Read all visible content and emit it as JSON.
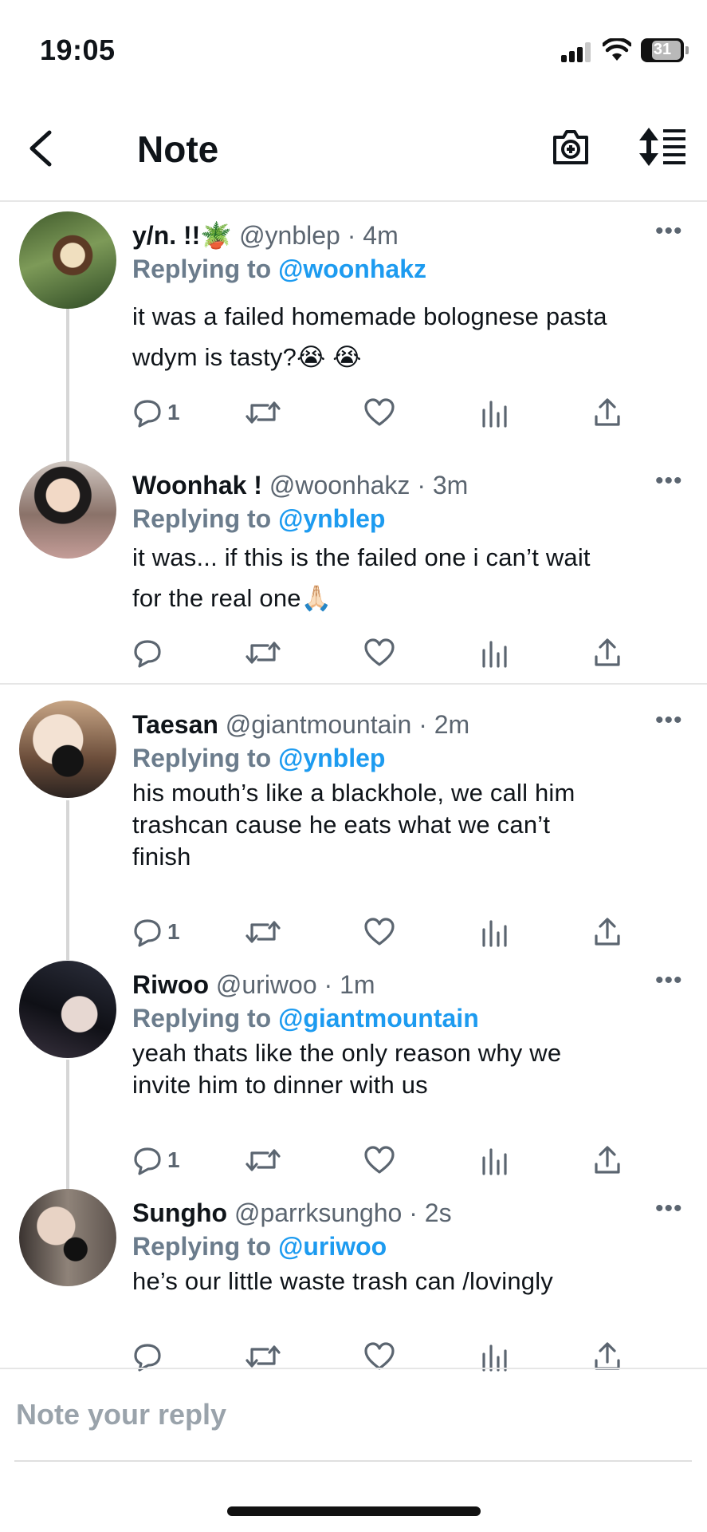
{
  "status_bar": {
    "time": "19:05",
    "battery": "31"
  },
  "header": {
    "title": "Note",
    "back_icon": "chevron-left-icon",
    "camera_icon": "camera-plus-icon",
    "sort_icon": "sort-lines-icon"
  },
  "tweets": [
    {
      "name": "y/n. !!🪴",
      "handle": "@ynblep · 4m",
      "reply_prefix": "Replying to",
      "reply_to": "@woonhakz",
      "lines": [
        "it was a failed homemade bolognese pasta",
        "wdym is tasty?😭 😭"
      ],
      "reply_count": "1"
    },
    {
      "name": "Woonhak !",
      "handle": "@woonhakz · 3m",
      "reply_prefix": "Replying to",
      "reply_to": "@ynblep",
      "lines": [
        "it was... if this is the failed one i can’t wait",
        "for the real one🙏🏻"
      ],
      "reply_count": ""
    },
    {
      "name": "Taesan",
      "handle": "@giantmountain · 2m",
      "reply_prefix": "Replying to",
      "reply_to": "@ynblep",
      "lines": [
        "his mouth’s like a blackhole, we call him",
        "trashcan cause he eats what we can’t",
        "finish"
      ],
      "reply_count": "1"
    },
    {
      "name": "Riwoo",
      "handle": "@uriwoo · 1m",
      "reply_prefix": "Replying to",
      "reply_to": "@giantmountain",
      "lines": [
        "yeah thats like the only reason why we",
        "invite him to dinner with us"
      ],
      "reply_count": "1"
    },
    {
      "name": "Sungho",
      "handle": "@parrksungho · 2s",
      "reply_prefix": "Replying to",
      "reply_to": "@uriwoo",
      "lines": [
        "he’s our little waste trash can /lovingly"
      ],
      "reply_count": ""
    }
  ],
  "composer": {
    "placeholder": "Note your reply"
  },
  "icons": {
    "more": "more-dots-icon",
    "reply": "reply-bubble-icon",
    "retweet": "retweet-icon",
    "like": "heart-icon",
    "views": "views-bars-icon",
    "share": "share-icon"
  }
}
